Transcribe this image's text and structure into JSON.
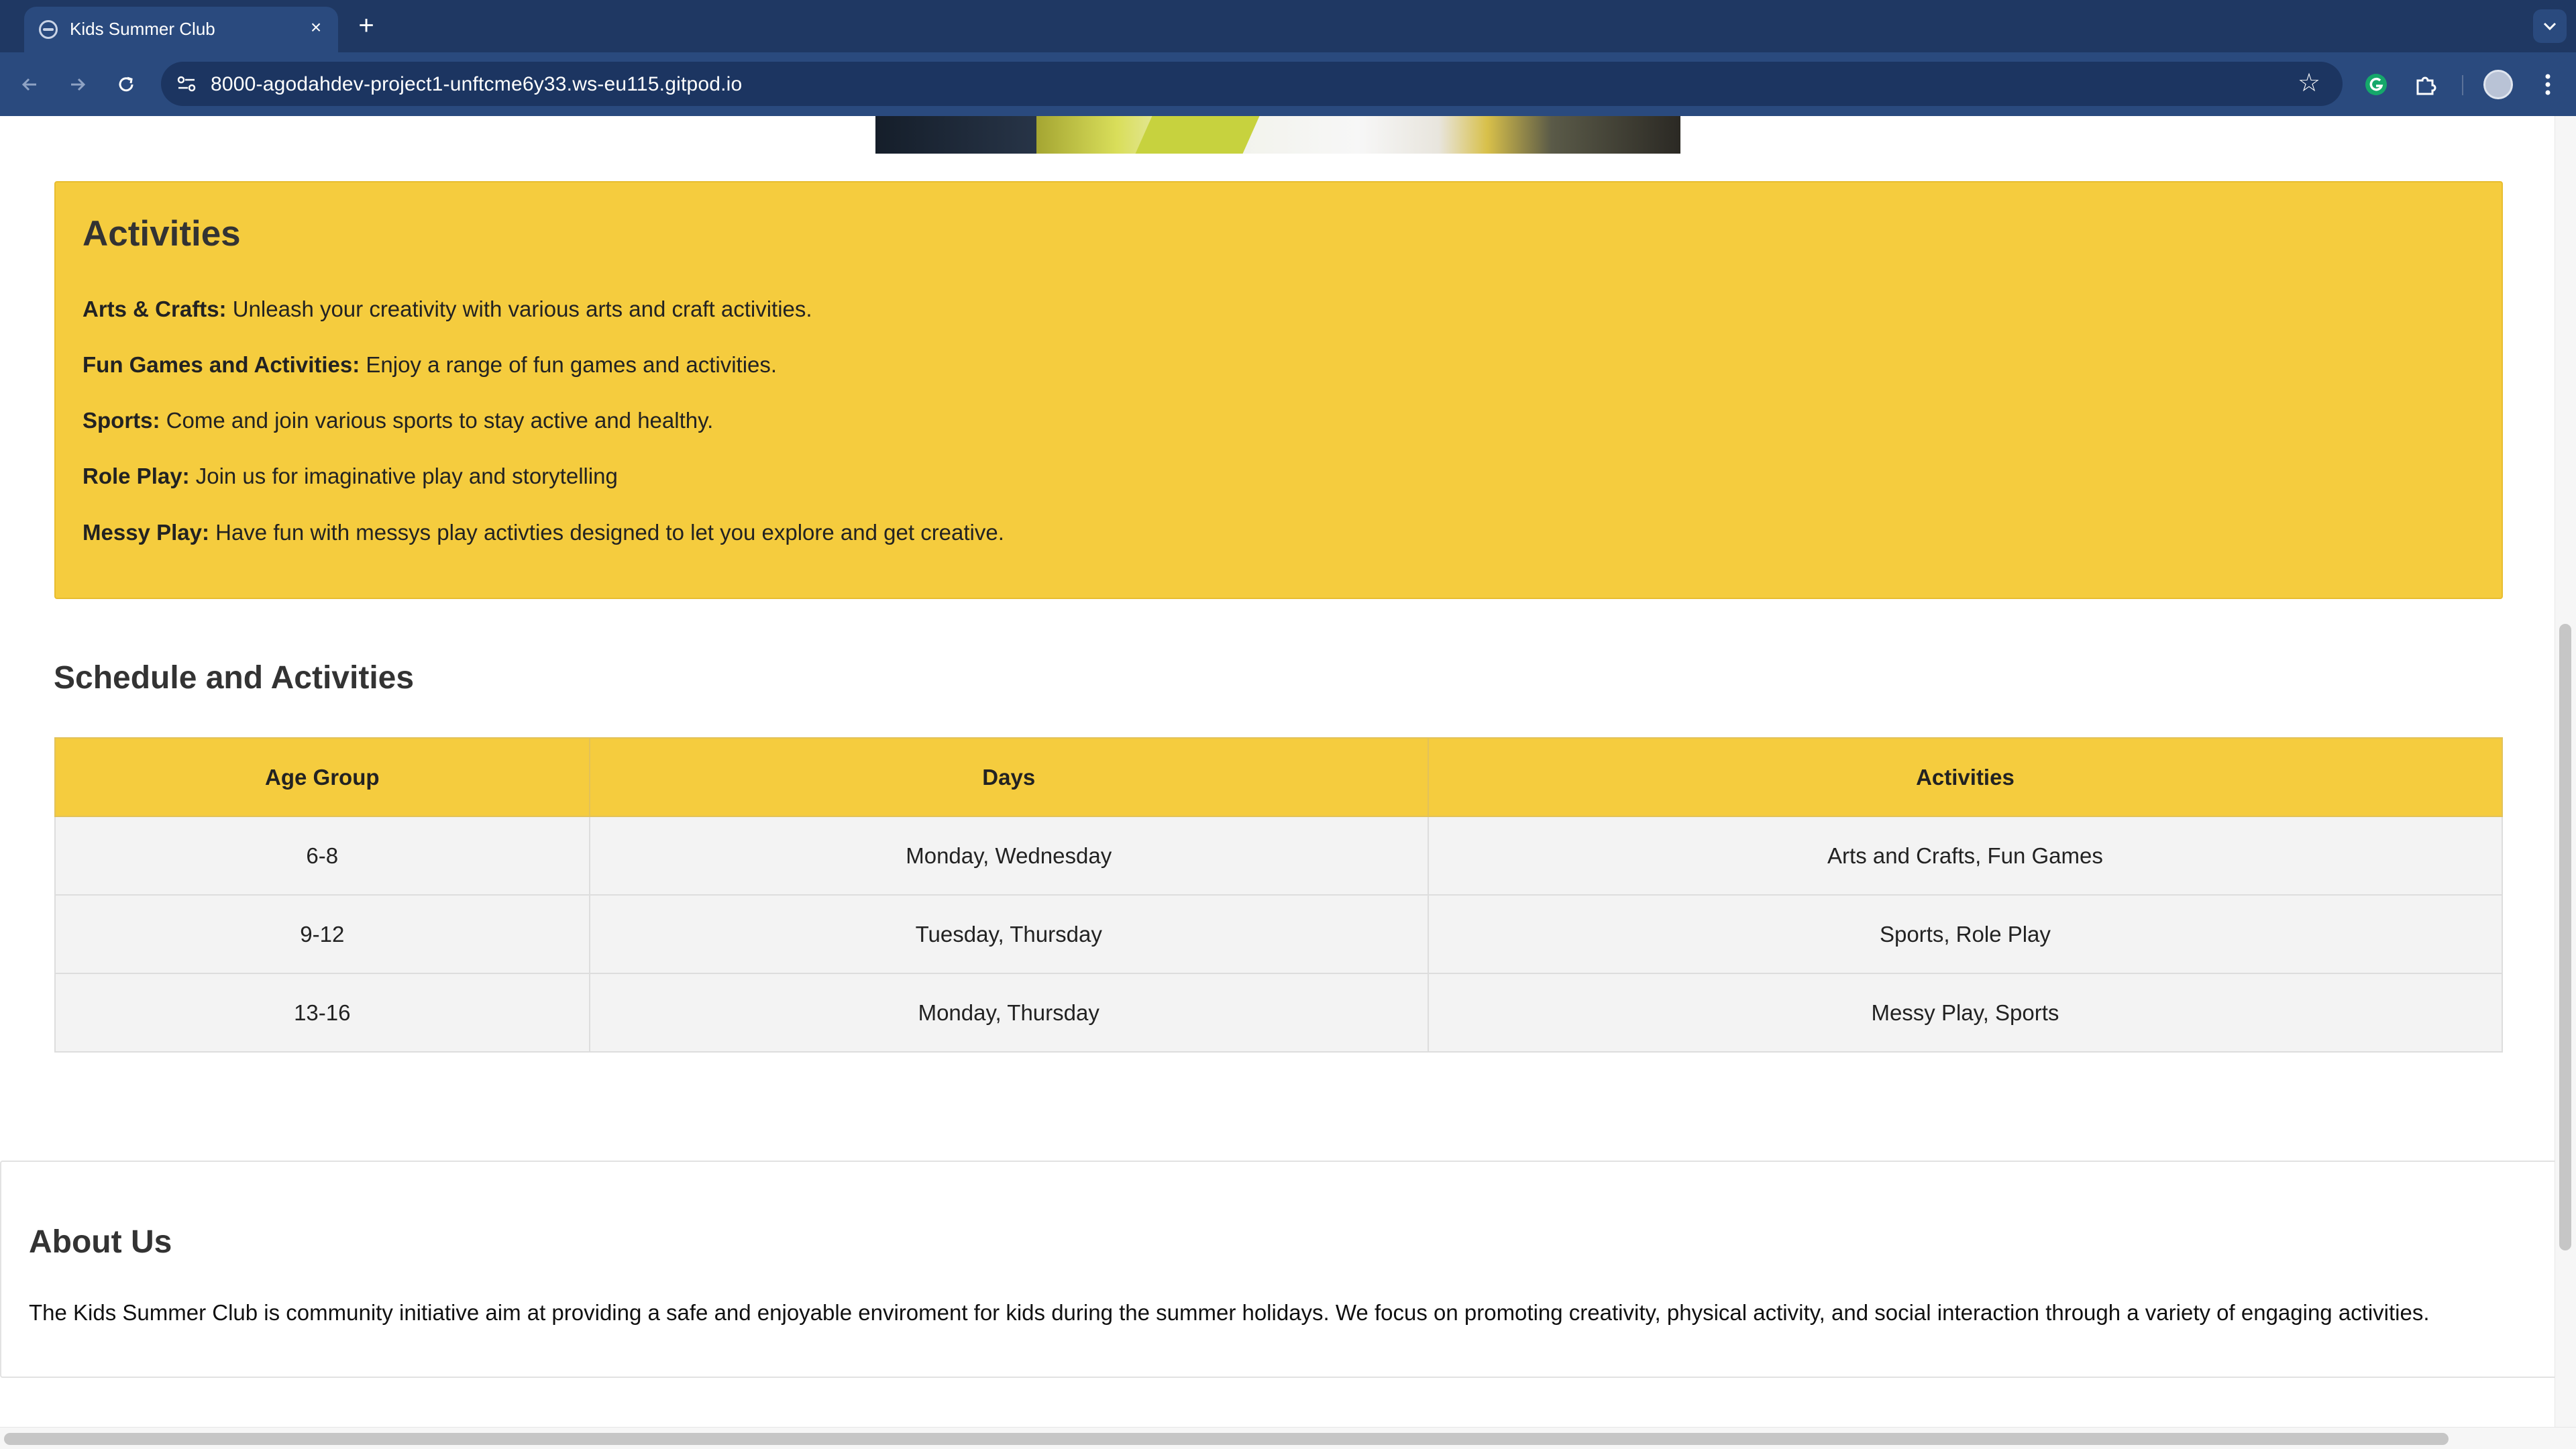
{
  "browser": {
    "tab_title": "Kids Summer Club",
    "tab_close": "×",
    "new_tab": "+",
    "url": "8000-agodahdev-project1-unftcme6y33.ws-eu115.gitpod.io",
    "bookmark": "☆"
  },
  "activities": {
    "title": "Activities",
    "items": [
      {
        "name": "Arts & Crafts:",
        "desc": " Unleash your creativity with various arts and craft activities."
      },
      {
        "name": "Fun Games and Activities:",
        "desc": " Enjoy a range of fun games and activities."
      },
      {
        "name": "Sports:",
        "desc": " Come and join various sports to stay active and healthy."
      },
      {
        "name": "Role Play:",
        "desc": " Join us for imaginative play and storytelling"
      },
      {
        "name": "Messy Play:",
        "desc": " Have fun with messys play activties designed to let you explore and get creative."
      }
    ]
  },
  "schedule": {
    "title": "Schedule and Activities",
    "headers": [
      "Age Group",
      "Days",
      "Activities"
    ],
    "rows": [
      [
        "6-8",
        "Monday, Wednesday",
        "Arts and Crafts, Fun Games"
      ],
      [
        "9-12",
        "Tuesday, Thursday",
        "Sports, Role Play"
      ],
      [
        "13-16",
        "Monday, Thursday",
        "Messy Play, Sports"
      ]
    ]
  },
  "about": {
    "title": "About Us",
    "text": "The Kids Summer Club is community initiative aim at providing a safe and enjoyable enviroment for kids during the summer holidays. We focus on promoting creativity, physical activity, and social interaction through a variety of engaging activities."
  },
  "colors": {
    "chrome": "#1f3863",
    "accent_yellow": "#f5cc3e",
    "row_gray": "#f3f3f3"
  }
}
